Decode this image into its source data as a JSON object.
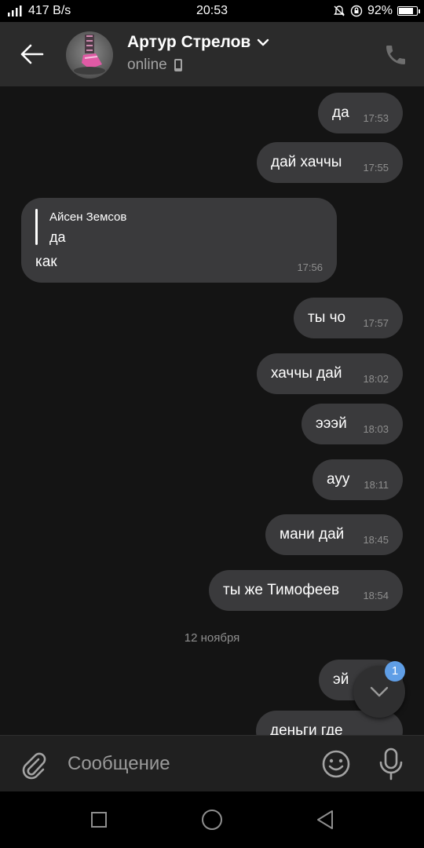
{
  "status_bar": {
    "network_speed": "417 B/s",
    "time": "20:53",
    "battery": "92%",
    "battery_level": 0.92
  },
  "header": {
    "contact_name": "Артур Стрелов",
    "status": "online",
    "icons": [
      "back-arrow-icon",
      "chevron-down-icon",
      "mobile-phone-icon",
      "phone-call-icon"
    ]
  },
  "messages": [
    {
      "direction": "out",
      "text": "да",
      "time": "17:53"
    },
    {
      "direction": "out",
      "text": "дай хаччы",
      "time": "17:55"
    },
    {
      "direction": "in",
      "reply_author": "Айсен Земсов",
      "reply_text": "да",
      "text": "как",
      "time": "17:56"
    },
    {
      "direction": "out",
      "text": "ты чо",
      "time": "17:57"
    },
    {
      "direction": "out",
      "text": "хаччы дай",
      "time": "18:02"
    },
    {
      "direction": "out",
      "text": "эээй",
      "time": "18:03"
    },
    {
      "direction": "out",
      "text": "ауу",
      "time": "18:11"
    },
    {
      "direction": "out",
      "text": "мани дай",
      "time": "18:45"
    },
    {
      "direction": "out",
      "text": "ты же Тимофеев",
      "time": "18:54"
    },
    {
      "direction": "out",
      "text": "эй",
      "time": ""
    },
    {
      "direction": "out",
      "text": "деньги где",
      "time": ""
    }
  ],
  "date_separator": "12 ноября",
  "scroll_down": {
    "unread_count": "1"
  },
  "composer": {
    "placeholder": "Сообщение"
  },
  "colors": {
    "background": "#141414",
    "header": "#2b2b2b",
    "bubble": "#3a3a3c",
    "badge": "#5f9ee6"
  }
}
